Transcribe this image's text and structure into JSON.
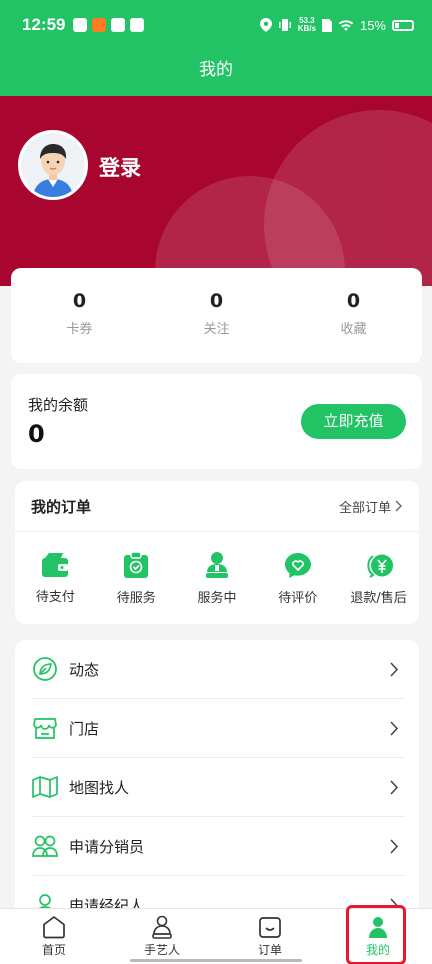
{
  "status_bar": {
    "time": "12:59",
    "net_speed_top": "53.3",
    "net_speed_unit": "KB/s",
    "battery": "15%"
  },
  "title": "我的",
  "profile": {
    "login_label": "登录"
  },
  "stats": [
    {
      "value": "0",
      "label": "卡券"
    },
    {
      "value": "0",
      "label": "关注"
    },
    {
      "value": "0",
      "label": "收藏"
    }
  ],
  "balance": {
    "title": "我的余额",
    "amount": "0",
    "button": "立即充值"
  },
  "orders": {
    "title": "我的订单",
    "all_link": "全部订单",
    "items": [
      {
        "label": "待支付",
        "icon": "wallet-icon"
      },
      {
        "label": "待服务",
        "icon": "clipboard-check-icon"
      },
      {
        "label": "服务中",
        "icon": "worker-icon"
      },
      {
        "label": "待评价",
        "icon": "heart-chat-icon"
      },
      {
        "label": "退款/售后",
        "icon": "yen-refund-icon"
      }
    ]
  },
  "menu": [
    {
      "label": "动态",
      "icon": "leaf-icon"
    },
    {
      "label": "门店",
      "icon": "store-icon"
    },
    {
      "label": "地图找人",
      "icon": "map-icon"
    },
    {
      "label": "申请分销员",
      "icon": "people-icon"
    },
    {
      "label": "申请经纪人",
      "icon": "agent-icon"
    }
  ],
  "tabs": [
    {
      "label": "首页",
      "icon": "home-icon"
    },
    {
      "label": "手艺人",
      "icon": "craftsman-icon"
    },
    {
      "label": "订单",
      "icon": "order-icon"
    },
    {
      "label": "我的",
      "icon": "user-icon",
      "active": true
    }
  ],
  "colors": {
    "primary": "#22c365",
    "hero": "#a8062f",
    "highlight": "#e5192d"
  }
}
